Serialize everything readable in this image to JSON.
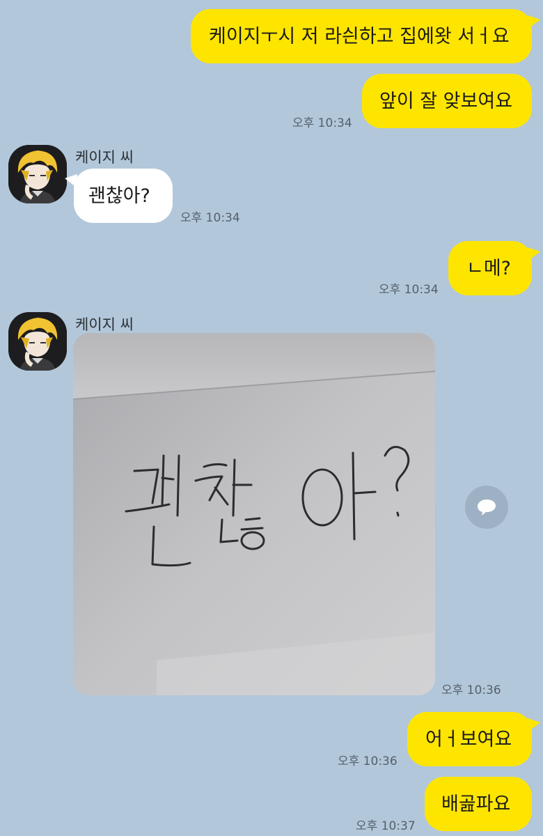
{
  "contact": {
    "name": "케이지 씨"
  },
  "messages": {
    "m1": "케이지ㅜ시 저 라싄하고 집에왓 서ㅓ요",
    "m2": "앞이 잘 앚보여요",
    "m2_time": "오후 10:34",
    "m3": "괜찮아?",
    "m3_time": "오후 10:34",
    "m4": "ㄴ메?",
    "m4_time": "오후 10:34",
    "photo_text": "괜찮아?",
    "photo_time": "오후 10:36",
    "m5": "어ㅓ보여요",
    "m5_time": "오후 10:36",
    "m6": "배곮파요",
    "m6_time": "오후 10:37"
  },
  "colors": {
    "background": "#b2c7da",
    "my_bubble": "#fee500",
    "their_bubble": "#ffffff"
  },
  "icons": {
    "share": "speech-bubble-icon"
  }
}
